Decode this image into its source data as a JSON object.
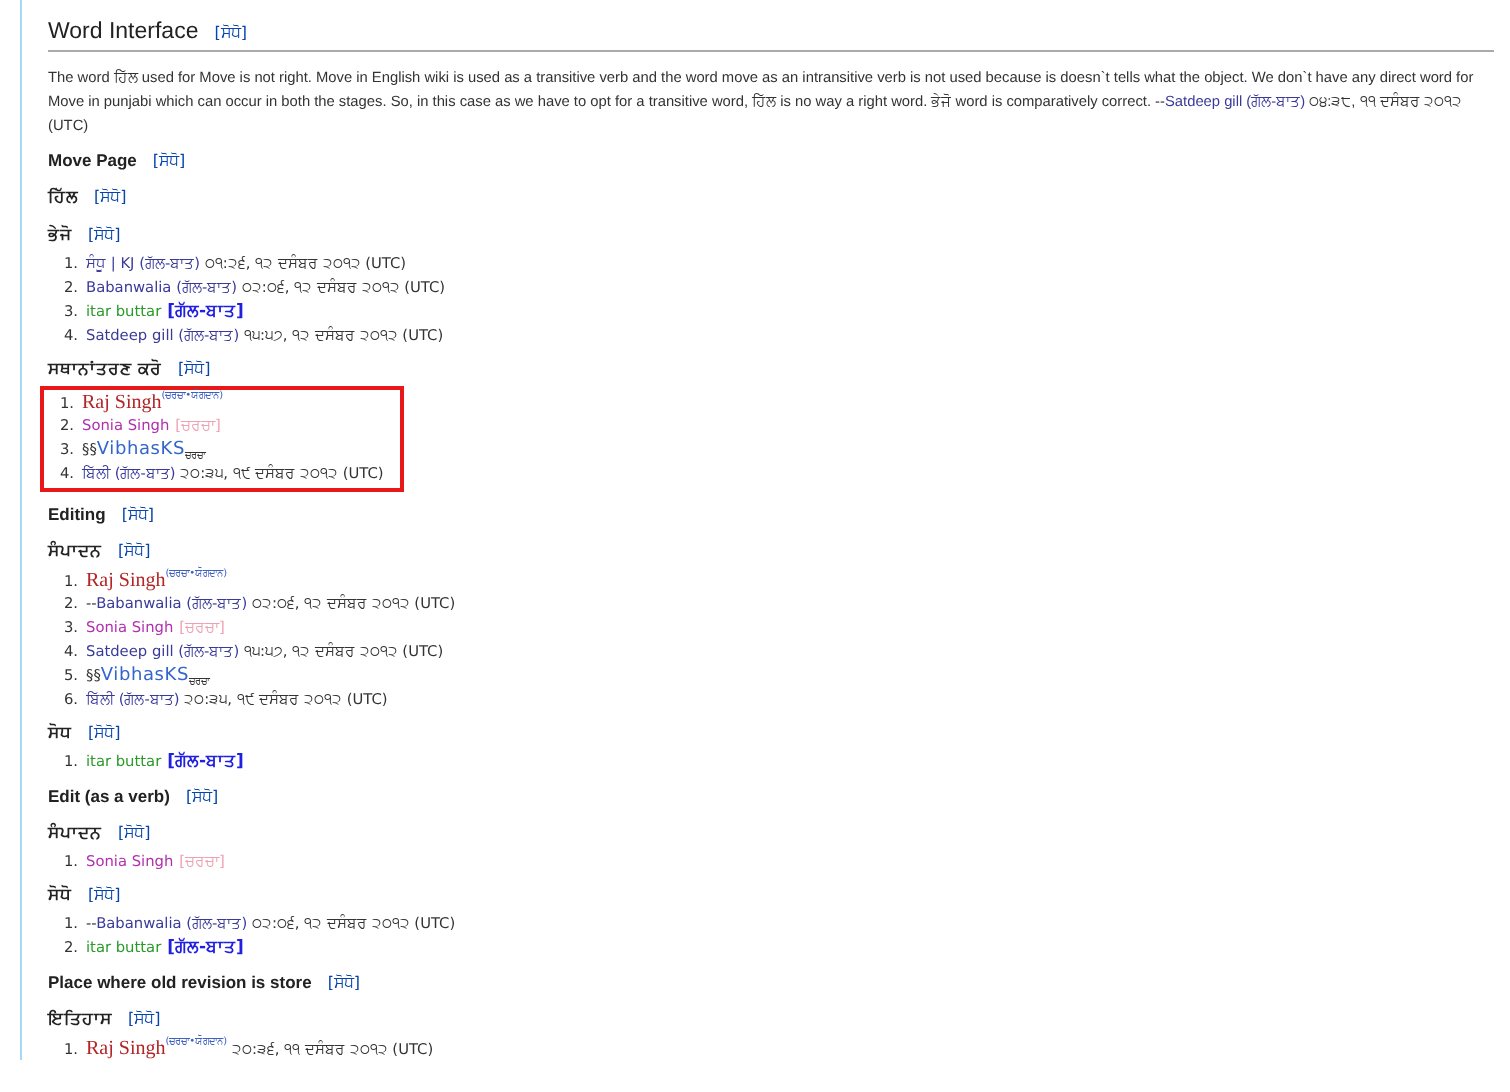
{
  "title": {
    "text": "Word Interface",
    "edit": "[ਸੋਧੋ]"
  },
  "paragraph": [
    {
      "text": "The word ਹਿੱਲ used for Move is not right. Move in English wiki is used as a transitive verb and the word move as an intransitive verb is not used because is doesn`t tells what the object. We don`t have any direct word for Move in punjabi which can occur in both the stages. So, in this case as we have to opt for a transitive word, ਹਿੱਲ is no way a right word. ਭੇਜੋ word is comparatively correct. --",
      "kind": "plain"
    },
    {
      "text": "Satdeep gill",
      "kind": "link"
    },
    {
      "text": " (ਗੱਲ-ਬਾਤ)",
      "kind": "link"
    },
    {
      "text": " ੦੪:੩੮, ੧੧ ਦਸੰਬਰ ੨੦੧੨ (UTC)",
      "kind": "time"
    }
  ],
  "sections": [
    {
      "kind": "h3",
      "title": "Move Page",
      "edit": "[ਸੋਧੋ]"
    },
    {
      "kind": "h4",
      "title": "ਹਿੱਲ",
      "edit": "[ਸੋਧੋ]"
    },
    {
      "kind": "h4",
      "title": "ਭੇਜੋ",
      "edit": "[ਸੋਧੋ]",
      "boxed": false,
      "items": [
        {
          "number": "1.",
          "parts": [
            {
              "text": "ਸੰਧੂ | KJ",
              "kind": "link"
            },
            {
              "text": " (ਗੱਲ-ਬਾਤ)",
              "kind": "link"
            },
            {
              "text": " ੦੧:੨੬, ੧੨ ਦਸੰਬਰ ੨੦੧੨ (UTC)",
              "kind": "time"
            }
          ]
        },
        {
          "number": "2.",
          "parts": [
            {
              "text": "Babanwalia",
              "kind": "link"
            },
            {
              "text": " (ਗੱਲ-ਬਾਤ)",
              "kind": "link"
            },
            {
              "text": " ੦੨:੦੬, ੧੨ ਦਸੰਬਰ ੨੦੧੨ (UTC)",
              "kind": "time"
            }
          ]
        },
        {
          "number": "3.",
          "parts": [
            {
              "text": "itar buttar",
              "kind": "green"
            },
            {
              "text": "[ਗੱਲ-ਬਾਤ]",
              "kind": "bold"
            }
          ]
        },
        {
          "number": "4.",
          "parts": [
            {
              "text": "Satdeep gill",
              "kind": "link"
            },
            {
              "text": " (ਗੱਲ-ਬਾਤ)",
              "kind": "link"
            },
            {
              "text": " ੧੫:੫੭, ੧੨ ਦਸੰਬਰ ੨੦੧੨ (UTC)",
              "kind": "time"
            }
          ]
        }
      ]
    },
    {
      "kind": "h4",
      "title": "ਸਥਾਨਾਂਤਰਣ ਕਰੋ",
      "edit": "[ਸੋਧੋ]",
      "boxed": true,
      "items": [
        {
          "number": "1.",
          "parts": [
            {
              "text": "Raj Singh",
              "kind": "serif"
            },
            {
              "text": "(ਚਰਚਾ•ਯੋਗਦਾਨ)",
              "kind": "sup"
            }
          ]
        },
        {
          "number": "2.",
          "parts": [
            {
              "text": "Sonia Singh",
              "kind": "pink"
            },
            {
              "text": "[ਚਰਚਾ]",
              "kind": "pale"
            }
          ]
        },
        {
          "number": "3.",
          "parts": [
            {
              "text": "§§",
              "kind": "plain"
            },
            {
              "text": "VibhasKS",
              "kind": "big"
            },
            {
              "text": "ਚਰਚਾ",
              "kind": "sub"
            }
          ]
        },
        {
          "number": "4.",
          "parts": [
            {
              "text": "ਬਿੱਲੀ",
              "kind": "link"
            },
            {
              "text": " (ਗੱਲ-ਬਾਤ)",
              "kind": "link"
            },
            {
              "text": " ੨੦:੩੫, ੧੯ ਦਸੰਬਰ ੨੦੧੨ (UTC)",
              "kind": "time"
            }
          ]
        }
      ]
    },
    {
      "kind": "h3",
      "title": "Editing",
      "edit": "[ਸੋਧੋ]"
    },
    {
      "kind": "h4",
      "title": "ਸੰਪਾਦਨ",
      "edit": "[ਸੋਧੋ]",
      "boxed": false,
      "items": [
        {
          "number": "1.",
          "parts": [
            {
              "text": "Raj Singh",
              "kind": "serif"
            },
            {
              "text": "(ਚਰਚਾ•ਯੋਗਦਾਨ)",
              "kind": "sup"
            }
          ]
        },
        {
          "number": "2.",
          "parts": [
            {
              "text": "--",
              "kind": "plain"
            },
            {
              "text": "Babanwalia",
              "kind": "link"
            },
            {
              "text": " (ਗੱਲ-ਬਾਤ)",
              "kind": "link"
            },
            {
              "text": " ੦੨:੦੬, ੧੨ ਦਸੰਬਰ ੨੦੧੨ (UTC)",
              "kind": "time"
            }
          ]
        },
        {
          "number": "3.",
          "parts": [
            {
              "text": "Sonia Singh",
              "kind": "pink"
            },
            {
              "text": "[ਚਰਚਾ]",
              "kind": "pale"
            }
          ]
        },
        {
          "number": "4.",
          "parts": [
            {
              "text": "Satdeep gill",
              "kind": "link"
            },
            {
              "text": " (ਗੱਲ-ਬਾਤ)",
              "kind": "link"
            },
            {
              "text": " ੧੫:੫੭, ੧੨ ਦਸੰਬਰ ੨੦੧੨ (UTC)",
              "kind": "time"
            }
          ]
        },
        {
          "number": "5.",
          "parts": [
            {
              "text": "§§",
              "kind": "plain"
            },
            {
              "text": "VibhasKS",
              "kind": "big"
            },
            {
              "text": "ਚਰਚਾ",
              "kind": "sub"
            }
          ]
        },
        {
          "number": "6.",
          "parts": [
            {
              "text": "ਬਿੱਲੀ",
              "kind": "link"
            },
            {
              "text": " (ਗੱਲ-ਬਾਤ)",
              "kind": "link"
            },
            {
              "text": " ੨੦:੩੫, ੧੯ ਦਸੰਬਰ ੨੦੧੨ (UTC)",
              "kind": "time"
            }
          ]
        }
      ]
    },
    {
      "kind": "h4",
      "title": "ਸੋਧ",
      "edit": "[ਸੋਧੋ]",
      "boxed": false,
      "items": [
        {
          "number": "1.",
          "parts": [
            {
              "text": "itar buttar",
              "kind": "green"
            },
            {
              "text": "[ਗੱਲ-ਬਾਤ]",
              "kind": "bold"
            }
          ]
        }
      ]
    },
    {
      "kind": "h3",
      "title": "Edit (as a verb)",
      "edit": "[ਸੋਧੋ]"
    },
    {
      "kind": "h4",
      "title": "ਸੰਪਾਦਨ",
      "edit": "[ਸੋਧੋ]",
      "boxed": false,
      "items": [
        {
          "number": "1.",
          "parts": [
            {
              "text": "Sonia Singh",
              "kind": "pink"
            },
            {
              "text": "[ਚਰਚਾ]",
              "kind": "pale"
            }
          ]
        }
      ]
    },
    {
      "kind": "h4",
      "title": "ਸੋਧੋ",
      "edit": "[ਸੋਧੋ]",
      "boxed": false,
      "items": [
        {
          "number": "1.",
          "parts": [
            {
              "text": "--",
              "kind": "plain"
            },
            {
              "text": "Babanwalia",
              "kind": "link"
            },
            {
              "text": " (ਗੱਲ-ਬਾਤ)",
              "kind": "link"
            },
            {
              "text": " ੦੨:੦੬, ੧੨ ਦਸੰਬਰ ੨੦੧੨ (UTC)",
              "kind": "time"
            }
          ]
        },
        {
          "number": "2.",
          "parts": [
            {
              "text": "itar buttar",
              "kind": "green"
            },
            {
              "text": "[ਗੱਲ-ਬਾਤ]",
              "kind": "bold"
            }
          ]
        }
      ]
    },
    {
      "kind": "h3",
      "title": "Place where old revision is store",
      "edit": "[ਸੋਧੋ]"
    },
    {
      "kind": "h4",
      "title": "ਇਤਿਹਾਸ",
      "edit": "[ਸੋਧੋ]",
      "boxed": false,
      "items": [
        {
          "number": "1.",
          "parts": [
            {
              "text": "Raj Singh",
              "kind": "serif"
            },
            {
              "text": "(ਚਰਚਾ•ਯੋਗਦਾਨ)",
              "kind": "sup"
            },
            {
              "text": " ੨੦:੩੬, ੧੧ ਦਸੰਬਰ ੨੦੧੨ (UTC)",
              "kind": "time"
            }
          ]
        }
      ]
    }
  ]
}
